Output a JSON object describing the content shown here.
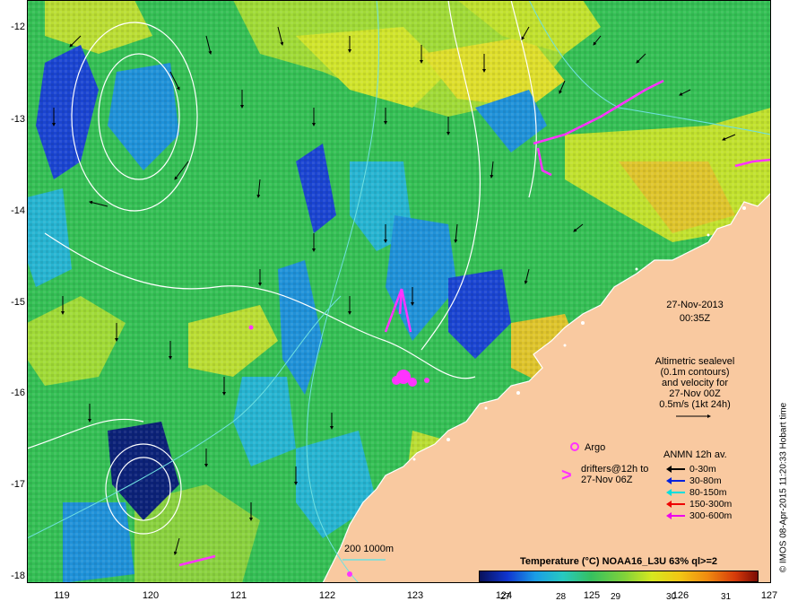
{
  "map": {
    "lat_ticks": [
      "-12",
      "-13",
      "-14",
      "-15",
      "-16",
      "-17",
      "-18"
    ],
    "lon_ticks": [
      "119",
      "120",
      "121",
      "122",
      "123",
      "124",
      "125",
      "126",
      "127"
    ],
    "lat_range": [
      -18,
      -11.65
    ],
    "lon_range": [
      118.6,
      127.0
    ],
    "land_color": "#f9c9a0",
    "coast_color": "#ffffff"
  },
  "annotations": {
    "date": "27-Nov-2013",
    "time": "00:35Z",
    "altimetric_lines": [
      "Altimetric sealevel",
      "(0.1m contours)",
      "and velocity for",
      "27-Nov 00Z",
      "0.5m/s (1kt 24h)"
    ],
    "argo_label": "Argo",
    "drifters_line1": "drifters@12h to",
    "drifters_line2": "27-Nov 06Z",
    "depth_contours": "200  1000m"
  },
  "anmn_legend": {
    "title": "ANMN 12h av.",
    "items": [
      {
        "label": "0-30m",
        "color": "#000000"
      },
      {
        "label": "30-80m",
        "color": "#0022dd"
      },
      {
        "label": "80-150m",
        "color": "#00dddd"
      },
      {
        "label": "150-300m",
        "color": "#ee0000"
      },
      {
        "label": "300-600m",
        "color": "#ee00ee"
      }
    ]
  },
  "colorbar": {
    "title": "Temperature (°C) NOAA16_L3U 63% ql>=2",
    "ticks": [
      "27",
      "28",
      "29",
      "30",
      "31"
    ]
  },
  "credit": "© IMOS 08-Apr-2015 11:20:33 Hobart time",
  "colors": {
    "sst_cool": "#1a3fd8",
    "sst_mid": "#3dbf4a",
    "sst_warm": "#d9e62a",
    "drifter": "#ff33ff",
    "contour": "#ffffff",
    "isobath": "#6fe0e0"
  }
}
